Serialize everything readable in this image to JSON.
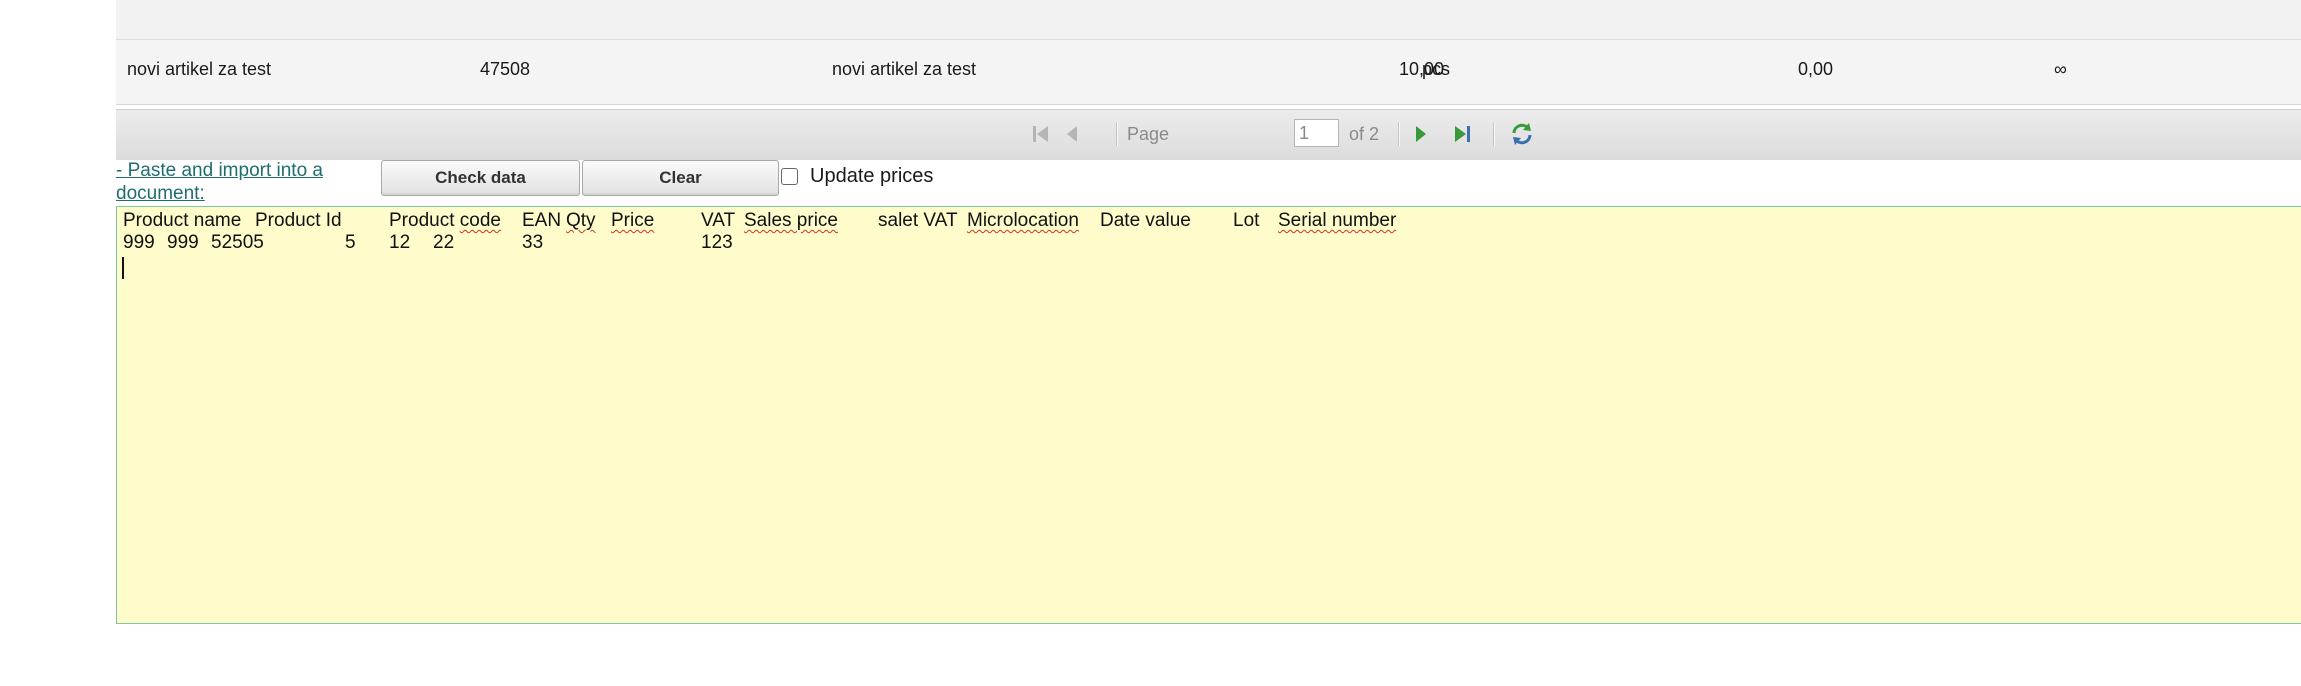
{
  "grid": {
    "row": {
      "name": "novi artikel za test",
      "id": "47508",
      "code": "novi artikel za test",
      "quantity": "10,00",
      "unit": "pcs",
      "price": "0,00",
      "stock": "∞"
    }
  },
  "pager": {
    "page_label": "Page",
    "page_value": "1",
    "of_label": "of 2"
  },
  "import": {
    "link_text": "- Paste and import into a document:",
    "check_button": "Check data",
    "clear_button": "Clear",
    "update_prices_label": "Update prices"
  },
  "textarea": {
    "headers": [
      "Product name",
      "Product Id",
      "Product code",
      "EAN",
      "Qty",
      "Price",
      "VAT",
      "Sales price",
      "salet VAT",
      "Microlocation",
      "Date value",
      "Lot",
      "Serial number"
    ],
    "row1": [
      "999",
      "999",
      "52505",
      "5",
      "12",
      "22",
      "33",
      "123"
    ]
  }
}
